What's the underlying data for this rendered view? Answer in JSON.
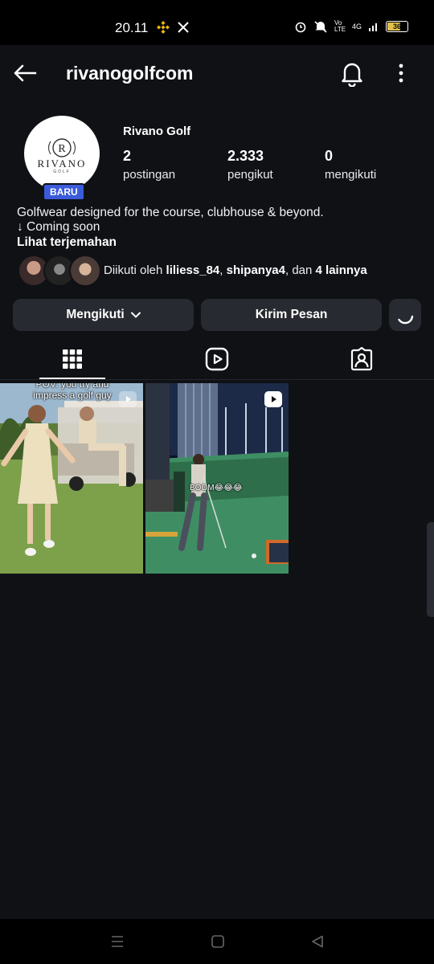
{
  "status_bar": {
    "time": "20.11",
    "network_label": "Vo LTE",
    "signal_label": "4G",
    "battery": "36"
  },
  "header": {
    "username": "rivanogolfcom"
  },
  "profile": {
    "avatar_text": "RIVANO",
    "avatar_subtext": "GOLF",
    "badge": "BARU",
    "display_name": "Rivano Golf",
    "stats": {
      "posts_value": "2",
      "posts_label": "postingan",
      "followers_value": "2.333",
      "followers_label": "pengikut",
      "following_value": "0",
      "following_label": "mengikuti"
    },
    "bio_line1": "Golfwear designed for the course, clubhouse & beyond.",
    "bio_line2": "↓ Coming soon",
    "translate_link": "Lihat terjemahan",
    "followed_by_prefix": "Diikuti oleh ",
    "followed_by_user1": "liliess_84",
    "followed_by_sep1": ", ",
    "followed_by_user2": "shipanya4",
    "followed_by_sep2": ", dan ",
    "followed_by_others": "4 lainnya"
  },
  "actions": {
    "following_label": "Mengikuti",
    "message_label": "Kirim Pesan"
  },
  "posts": [
    {
      "caption": "POV: you try and impress a golf guy"
    },
    {
      "caption": "BOOM😂😂😂"
    }
  ],
  "icons": [
    "arrow-left",
    "bell",
    "more-vertical",
    "chevron-down",
    "grid",
    "reels",
    "tagged",
    "reel-badge",
    "nav-menu",
    "nav-home",
    "nav-back"
  ]
}
